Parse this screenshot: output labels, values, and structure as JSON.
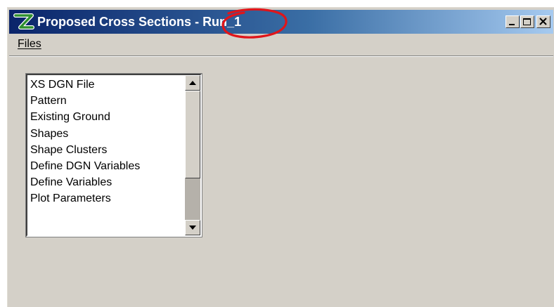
{
  "window": {
    "title_main": "Proposed Cross Sections",
    "title_sep": " - ",
    "title_run": "Run_1",
    "app_icon": "green-z-logo-icon",
    "annotation_color": "#e0151a",
    "caption_buttons": [
      "minimize-icon",
      "maximize-icon",
      "close-icon"
    ]
  },
  "menu": {
    "items": [
      {
        "label": "Files"
      }
    ]
  },
  "listbox": {
    "items": [
      "XS DGN File",
      "Pattern",
      "Existing Ground",
      "Shapes",
      "Shape Clusters",
      "Define DGN Variables",
      "Define Variables",
      "Plot Parameters"
    ],
    "scroll_position_fraction": 0.55,
    "visible_fraction": 0.55,
    "icons": [
      "scroll-up-arrow-icon",
      "scroll-down-arrow-icon"
    ]
  },
  "colors": {
    "face": "#d4d0c8",
    "title_start": "#0a246a",
    "title_end": "#a6caf0",
    "title_text": "#ffffff",
    "annotation": "#e0151a"
  }
}
